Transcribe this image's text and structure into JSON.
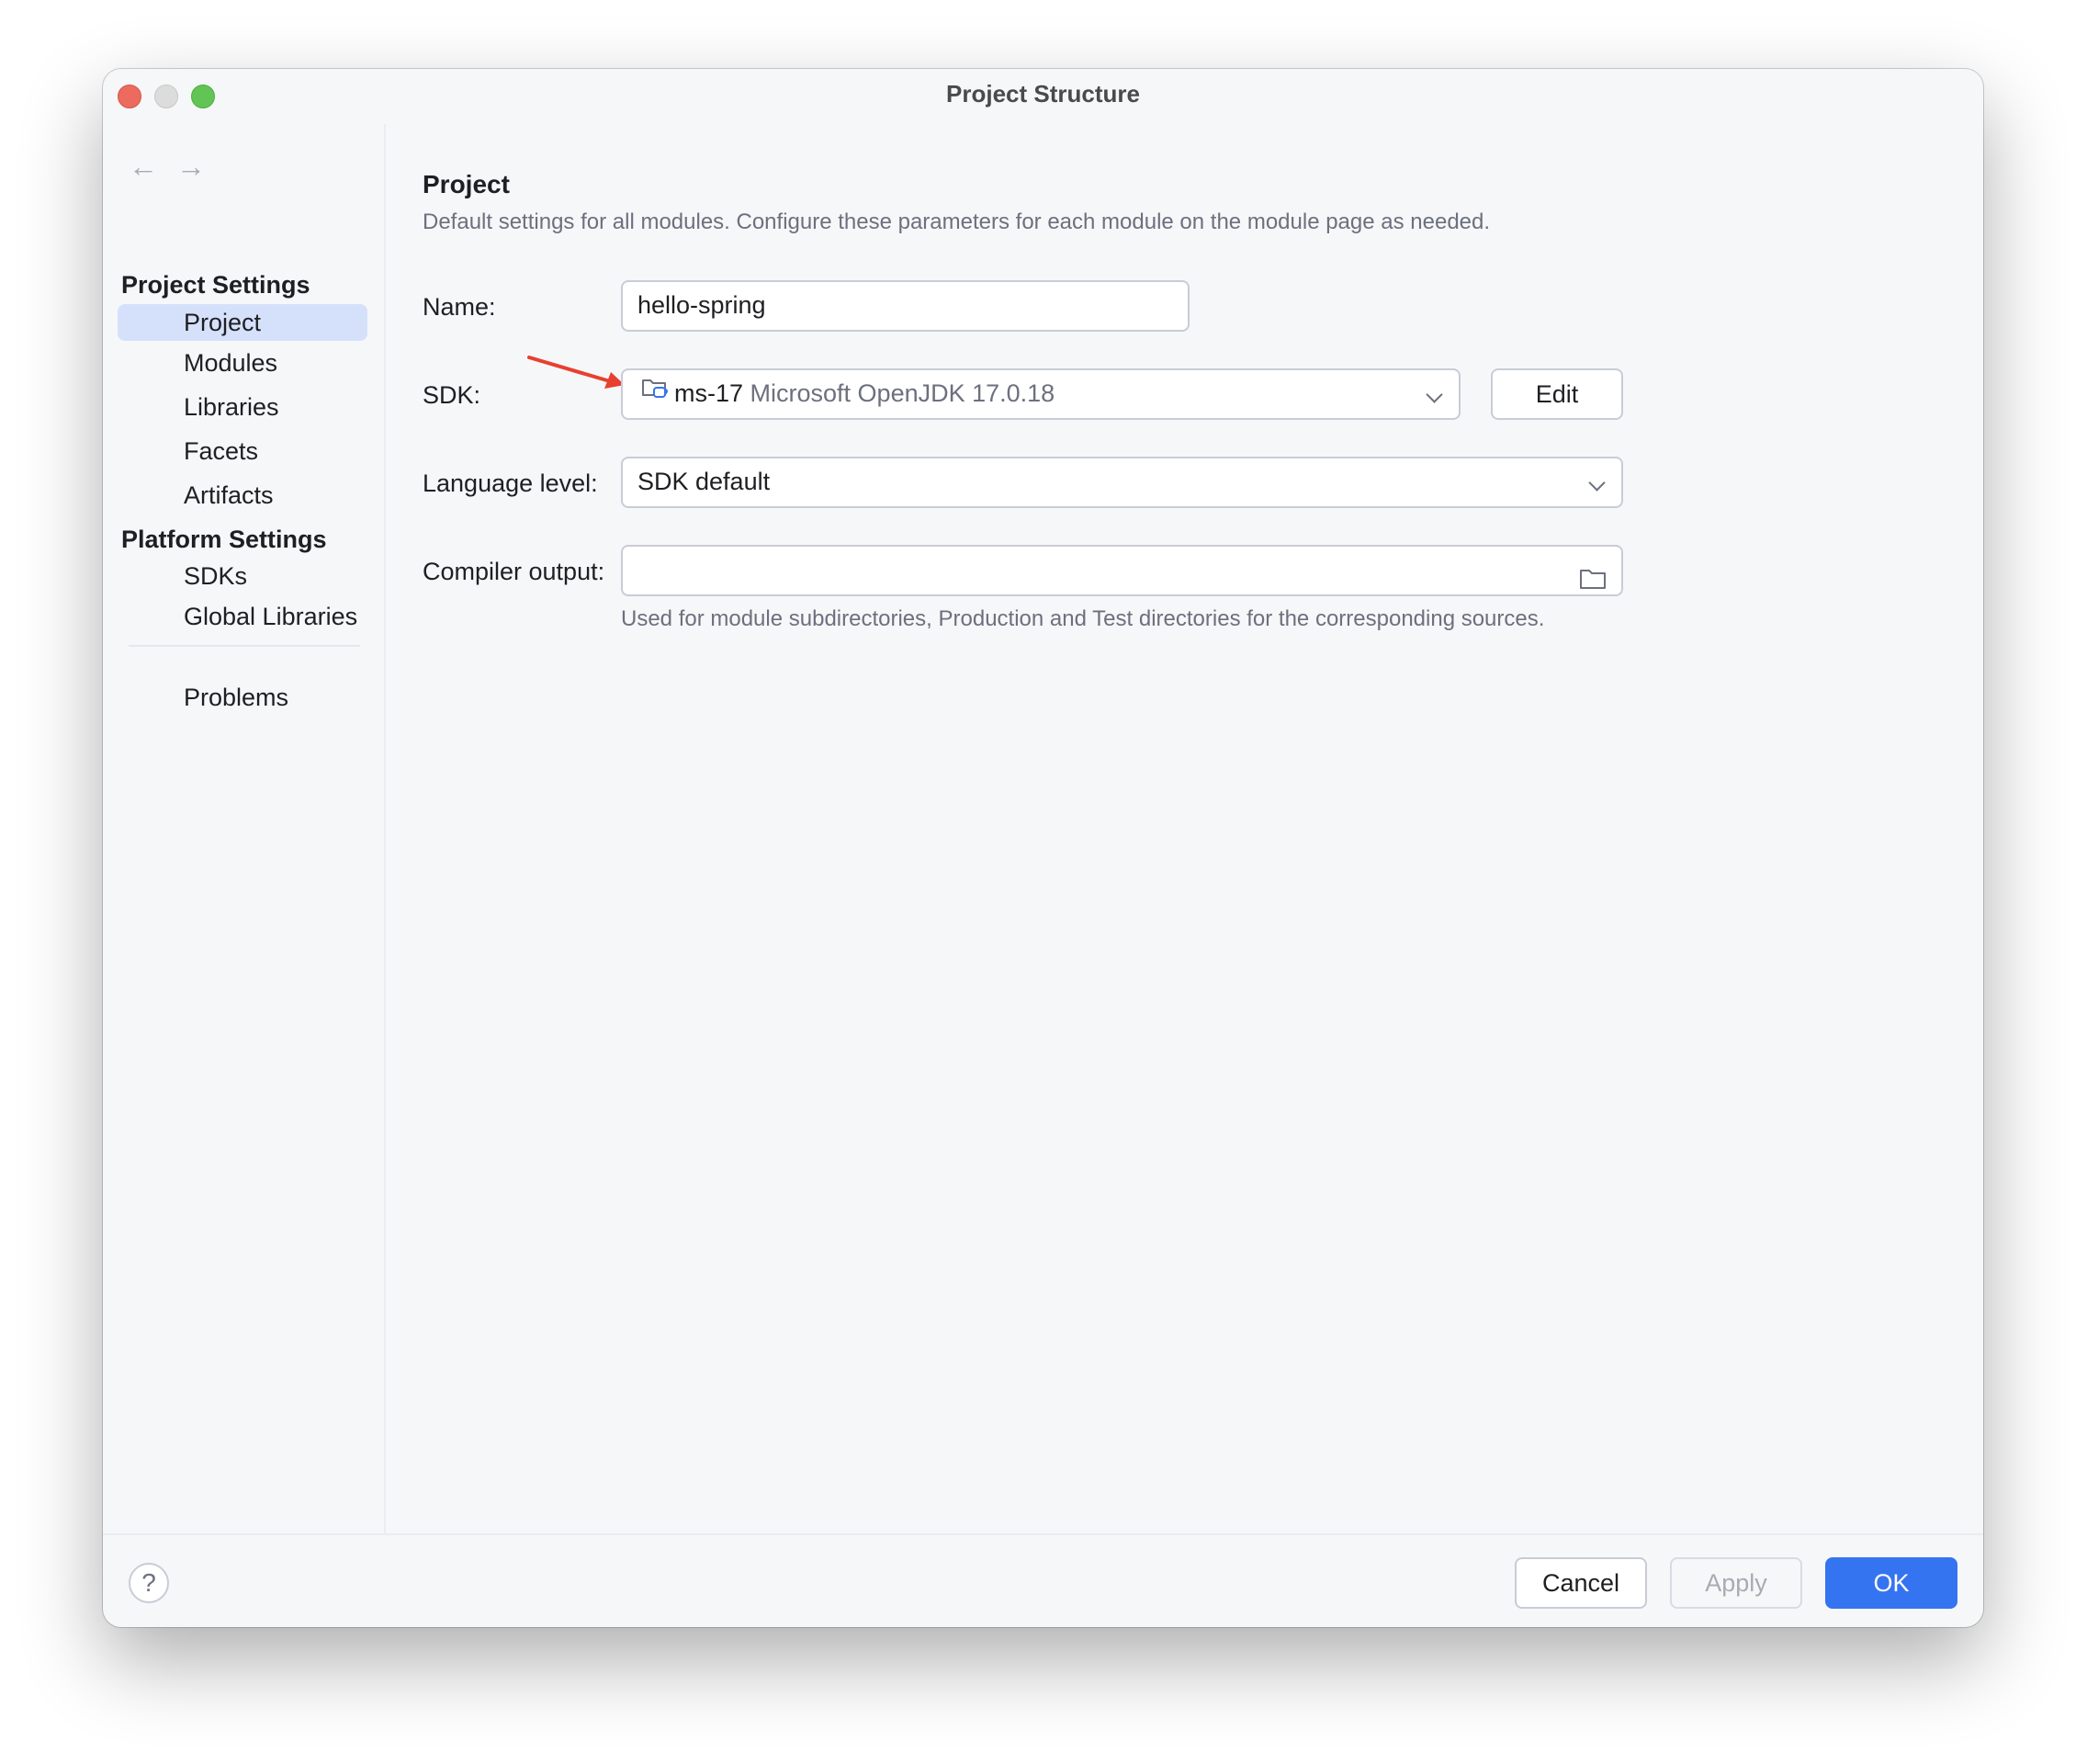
{
  "window": {
    "title": "Project Structure"
  },
  "sidebar": {
    "back_icon": "arrow-left-icon",
    "forward_icon": "arrow-right-icon",
    "project_settings_header": "Project Settings",
    "project_settings_items": [
      {
        "label": "Project",
        "selected": true
      },
      {
        "label": "Modules",
        "selected": false
      },
      {
        "label": "Libraries",
        "selected": false
      },
      {
        "label": "Facets",
        "selected": false
      },
      {
        "label": "Artifacts",
        "selected": false
      }
    ],
    "platform_settings_header": "Platform Settings",
    "platform_settings_items": [
      {
        "label": "SDKs"
      },
      {
        "label": "Global Libraries"
      }
    ],
    "problems_label": "Problems"
  },
  "content": {
    "title": "Project",
    "description": "Default settings for all modules. Configure these parameters for each module on the module page as needed.",
    "name_label": "Name:",
    "name_value": "hello-spring",
    "sdk_label": "SDK:",
    "sdk_name": "ms-17",
    "sdk_detail": "Microsoft OpenJDK 17.0.18",
    "sdk_icon": "jdk-folder-icon",
    "edit_button": "Edit",
    "language_level_label": "Language level:",
    "language_level_value": "SDK default",
    "compiler_output_label": "Compiler output:",
    "compiler_output_value": "",
    "compiler_output_hint": "Used for module subdirectories, Production and Test directories for the corresponding sources."
  },
  "footer": {
    "help_label": "?",
    "cancel_button": "Cancel",
    "apply_button": "Apply",
    "ok_button": "OK"
  },
  "colors": {
    "accent": "#3574f0",
    "selection": "#d5e1fb",
    "annotation_arrow": "#e8402f"
  }
}
